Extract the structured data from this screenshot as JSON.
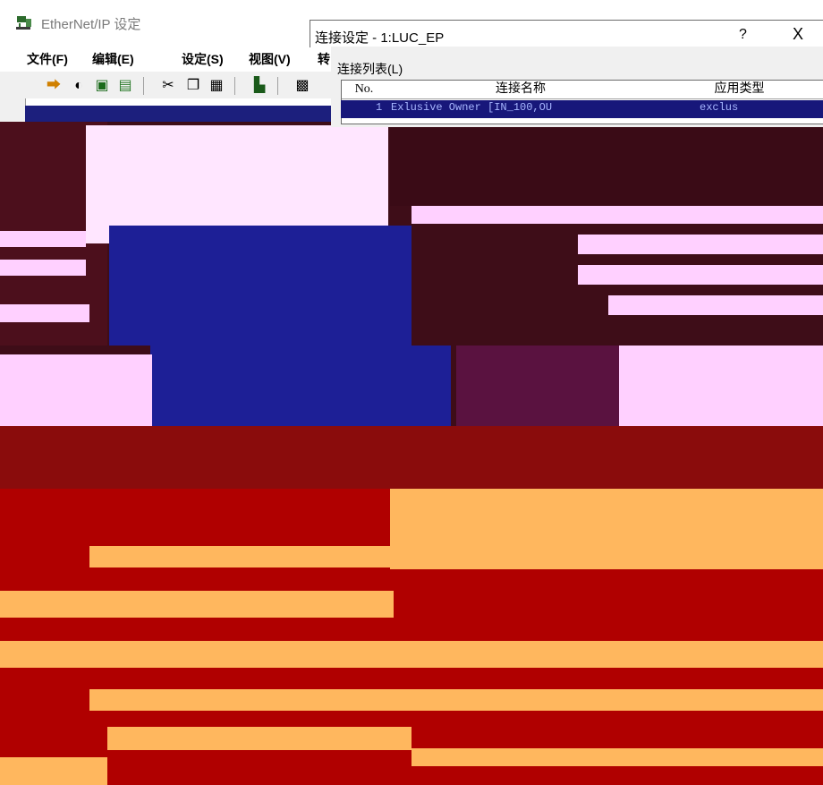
{
  "main_window": {
    "title": "EtherNet/IP 设定",
    "menu": [
      "文件(F)",
      "编辑(E)",
      "设定(S)",
      "视图(V)",
      "转"
    ]
  },
  "dialog": {
    "title": "连接设定 - 1:LUC_EP",
    "help_label": "?",
    "close_label": "X",
    "list_label": "连接列表(L)",
    "table": {
      "columns": [
        "No.",
        "连接名称",
        "应用类型"
      ],
      "rows": [
        {
          "no": "1",
          "name": "Exlusive Owner [IN_100,OU",
          "type": "exclus"
        }
      ]
    }
  },
  "icons": [
    "app-icon",
    "toolbar-icons"
  ],
  "colors": {
    "selection": "#17177a",
    "glitch_red": "#b00000",
    "glitch_pink": "#ffc8ff",
    "glitch_orange": "#ffb75e"
  }
}
